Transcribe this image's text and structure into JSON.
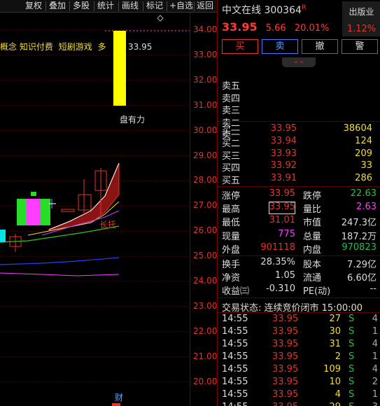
{
  "toolbar": {
    "items": [
      "复权",
      "叠加",
      "多股",
      "统计",
      "画线",
      "标记",
      "+自选",
      "返回"
    ],
    "close_label": "x"
  },
  "chart": {
    "concept_label": "概念",
    "concept_tags": [
      "知识付费",
      "短剧游戏",
      "多"
    ],
    "last_price_tag": "33.95",
    "low_marker": "盘有力",
    "cai_marker": "财",
    "mid_marker": "长托",
    "yticks": [
      "34.00",
      "33.00",
      "32.00",
      "31.00",
      "30.00",
      "29.00",
      "28.00",
      "27.00",
      "26.00",
      "25.00",
      "24.00",
      "23.00",
      "22.00",
      "21.00",
      "20.00"
    ],
    "colors": {
      "up": "#e6332a",
      "up_fill": "#a01818",
      "ma_white": "#ffffff",
      "ma_yellow": "#f4dc3c",
      "ma_green": "#28c828",
      "ma_blue": "#2b3cff",
      "ma_magenta": "#ff3cff"
    }
  },
  "stock": {
    "name": "中文在线",
    "code": "300364",
    "flag": "R",
    "price": "33.95",
    "change": "5.66",
    "change_pct": "20.01%",
    "sector_name": "出版业",
    "sector_pct": "1.12%"
  },
  "trade_buttons": [
    "买",
    "卖",
    "撤",
    "警"
  ],
  "collapse_icon": "⌄⌄",
  "sell_levels": [
    {
      "label": "卖五",
      "price": "",
      "vol": ""
    },
    {
      "label": "卖四",
      "price": "",
      "vol": ""
    },
    {
      "label": "卖三",
      "price": "",
      "vol": ""
    },
    {
      "label": "卖二",
      "price": "",
      "vol": ""
    },
    {
      "label": "卖一",
      "price": "",
      "vol": ""
    }
  ],
  "buy_levels": [
    {
      "label": "买一",
      "price": "33.95",
      "vol": "38604"
    },
    {
      "label": "买二",
      "price": "33.94",
      "vol": "124"
    },
    {
      "label": "买三",
      "price": "33.93",
      "vol": "209"
    },
    {
      "label": "买四",
      "price": "33.92",
      "vol": "33"
    },
    {
      "label": "买五",
      "price": "33.91",
      "vol": "286"
    }
  ],
  "stats_left": [
    {
      "k": "涨停",
      "v": "33.95",
      "color": "#e6332a"
    },
    {
      "k": "最高",
      "v": "33.95",
      "color": "#e6332a"
    },
    {
      "k": "最低",
      "v": "31.01",
      "color": "#e6332a"
    },
    {
      "k": "现量",
      "v": "775",
      "color": "#ff3cff"
    },
    {
      "k": "外盘",
      "v": "901118",
      "color": "#e6332a"
    }
  ],
  "stats_right": [
    {
      "k": "跌停",
      "v": "22.63",
      "color": "#22c24a"
    },
    {
      "k": "量比",
      "v": "2.63",
      "color": "#ff3cff"
    },
    {
      "k": "市值",
      "v": "247.3亿",
      "color": "#ddd"
    },
    {
      "k": "总量",
      "v": "187.2万",
      "color": "#ddd"
    },
    {
      "k": "内盘",
      "v": "970823",
      "color": "#22c24a"
    }
  ],
  "stats2_left": [
    {
      "k": "换手",
      "v": "28.35%",
      "color": "#ddd"
    },
    {
      "k": "净资",
      "v": "1.05",
      "color": "#ddd"
    },
    {
      "k": "收益㈢",
      "v": "-0.310",
      "color": "#ddd"
    }
  ],
  "stats2_right": [
    {
      "k": "股本",
      "v": "7.29亿",
      "color": "#ddd"
    },
    {
      "k": "流通",
      "v": "6.60亿",
      "color": "#ddd"
    },
    {
      "k": "PE(动)",
      "v": "--",
      "color": "#ddd"
    }
  ],
  "trade_status": "交易状态: 连续竞价闭市 15:00:00",
  "ticks": [
    {
      "time": "14:55",
      "price": "33.95",
      "vol": "27",
      "side": "S",
      "n": "4"
    },
    {
      "time": "14:55",
      "price": "33.95",
      "vol": "30",
      "side": "S",
      "n": "1"
    },
    {
      "time": "14:55",
      "price": "33.95",
      "vol": "31",
      "side": "S",
      "n": "4"
    },
    {
      "time": "14:55",
      "price": "33.95",
      "vol": "2",
      "side": "S",
      "n": "1"
    },
    {
      "time": "14:55",
      "price": "33.95",
      "vol": "109",
      "side": "S",
      "n": "4"
    },
    {
      "time": "14:55",
      "price": "33.95",
      "vol": "10",
      "side": "S",
      "n": "2"
    },
    {
      "time": "14:55",
      "price": "33.95",
      "vol": "4",
      "side": "S",
      "n": "1"
    },
    {
      "time": "14:55",
      "price": "33.95",
      "vol": "29",
      "side": "S",
      "n": "3"
    }
  ]
}
